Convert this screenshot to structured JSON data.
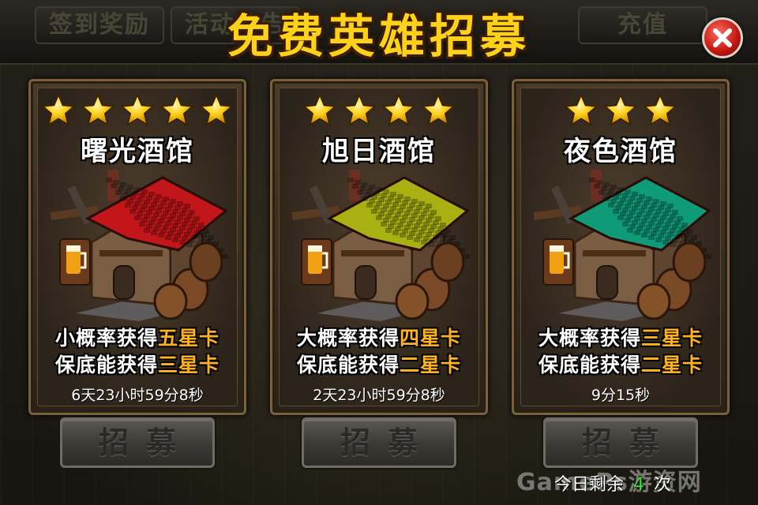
{
  "header": {
    "title": "免费英雄招募",
    "tabs": [
      {
        "label": "签到奖励"
      },
      {
        "label": "活动公告"
      },
      {
        "label": "充值"
      }
    ]
  },
  "cards": [
    {
      "stars": 5,
      "name": "曙光酒馆",
      "line1_prefix": "小概率获得",
      "line1_highlight": "五星卡",
      "line2_prefix": "保底能获得",
      "line2_highlight": "三星卡",
      "timer": "6天23小时59分8秒",
      "roof_color": "#c3161a",
      "button_label": "招募"
    },
    {
      "stars": 4,
      "name": "旭日酒馆",
      "line1_prefix": "大概率获得",
      "line1_highlight": "四星卡",
      "line2_prefix": "保底能获得",
      "line2_highlight": "二星卡",
      "timer": "2天23小时59分8秒",
      "roof_color": "#a8b012",
      "button_label": "招募"
    },
    {
      "stars": 3,
      "name": "夜色酒馆",
      "line1_prefix": "大概率获得",
      "line1_highlight": "三星卡",
      "line2_prefix": "保底能获得",
      "line2_highlight": "二星卡",
      "timer": "9分15秒",
      "roof_color": "#0f9a78",
      "button_label": "招募"
    }
  ],
  "footer": {
    "remain_prefix": "今日剩余",
    "remain_count": "4",
    "remain_suffix": "次",
    "watermark": "GamePs游资网"
  },
  "colors": {
    "title": "#ffd21a",
    "highlight": "#ffb21e",
    "count": "#3fe03f"
  },
  "icons": [
    "star-icon",
    "close-icon",
    "beer-mug-icon"
  ]
}
